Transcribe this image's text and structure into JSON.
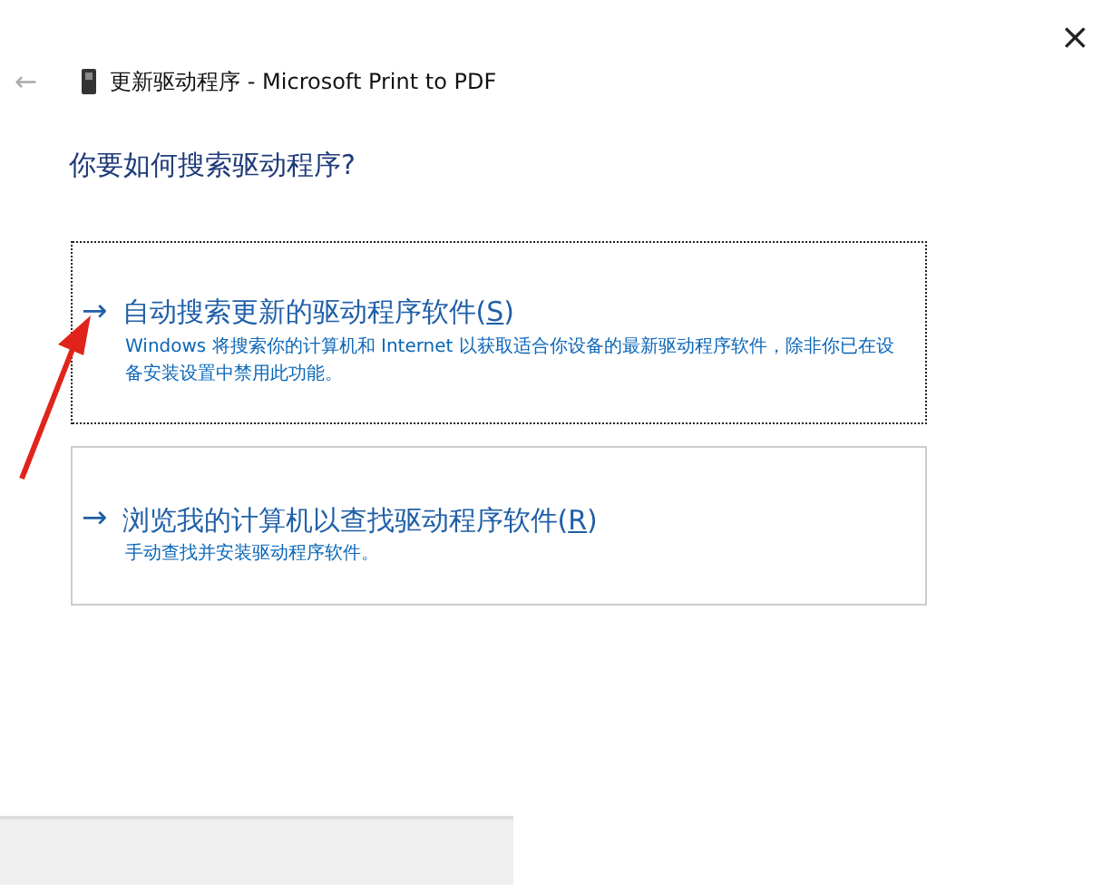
{
  "window": {
    "close": "×",
    "back": "←",
    "title": "更新驱动程序 - Microsoft Print to PDF"
  },
  "heading": "你要如何搜索驱动程序?",
  "options": [
    {
      "arrow": "→",
      "label_before": "自动搜索更新的驱动程序软件(",
      "access_key": "S",
      "label_after": ")",
      "description": "Windows 将搜索你的计算机和 Internet 以获取适合你设备的最新驱动程序软件，除非你已在设备安装设置中禁用此功能。",
      "selected": true
    },
    {
      "arrow": "→",
      "label_before": "浏览我的计算机以查找驱动程序软件(",
      "access_key": "R",
      "label_after": ")",
      "description": "手动查找并安装驱动程序软件。",
      "selected": false
    }
  ]
}
